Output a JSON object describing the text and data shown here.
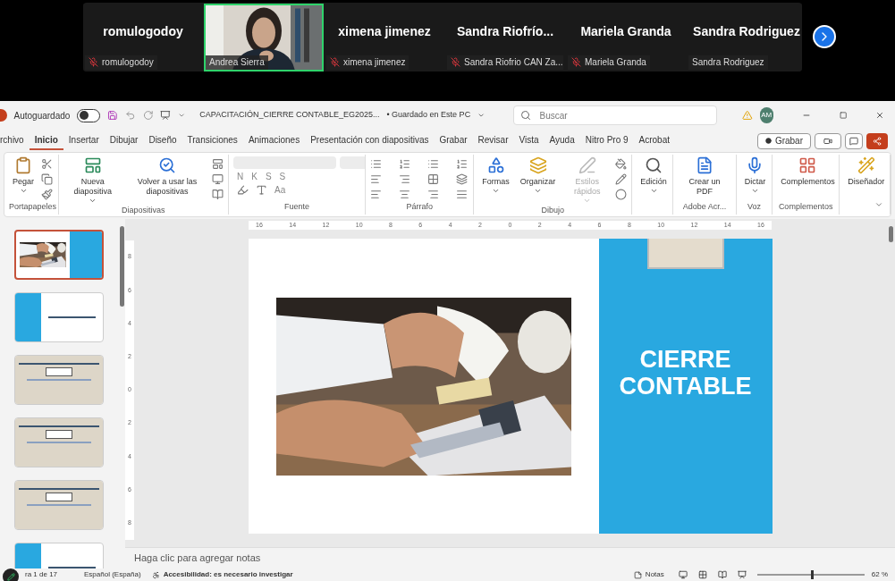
{
  "meeting": {
    "participants": [
      {
        "kind": "name",
        "name": "romulogodoy",
        "caption": "romulogodoy",
        "muted": true,
        "speaking": false
      },
      {
        "kind": "video",
        "caption": "Andrea Sierra",
        "muted": false,
        "speaking": true
      },
      {
        "kind": "name",
        "name": "ximena jimenez",
        "caption": "ximena jimenez",
        "muted": true,
        "speaking": false
      },
      {
        "kind": "name",
        "name": "Sandra  Riofrío...",
        "caption": "Sandra Riofrio CAN Za...",
        "muted": true,
        "speaking": false
      },
      {
        "kind": "name",
        "name": "Mariela Granda",
        "caption": "Mariela Granda",
        "muted": true,
        "speaking": false
      },
      {
        "kind": "name",
        "name": "Sandra Rodriguez",
        "caption": "Sandra Rodriguez",
        "muted": false,
        "speaking": false
      }
    ]
  },
  "title_bar": {
    "autosave_label": "Autoguardado",
    "autosave_on": false,
    "file_title": "CAPACITACIÓN_CIERRE CONTABLE_EG2025...",
    "save_status": "• Guardado en Este PC",
    "search_placeholder": "Buscar",
    "avatar": "AM"
  },
  "tabs": [
    {
      "label": "rchivo",
      "selected": false
    },
    {
      "label": "Inicio",
      "selected": true
    },
    {
      "label": "Insertar",
      "selected": false
    },
    {
      "label": "Dibujar",
      "selected": false
    },
    {
      "label": "Diseño",
      "selected": false
    },
    {
      "label": "Transiciones",
      "selected": false
    },
    {
      "label": "Animaciones",
      "selected": false
    },
    {
      "label": "Presentación con diapositivas",
      "selected": false
    },
    {
      "label": "Grabar",
      "selected": false
    },
    {
      "label": "Revisar",
      "selected": false
    },
    {
      "label": "Vista",
      "selected": false
    },
    {
      "label": "Ayuda",
      "selected": false
    },
    {
      "label": "Nitro Pro 9",
      "selected": false
    },
    {
      "label": "Acrobat",
      "selected": false
    }
  ],
  "record_button": "Grabar",
  "ribbon": [
    {
      "kind": "clipboard",
      "label": "Portapapeles",
      "buttons": [
        {
          "kind": "paste",
          "label": "Pegar",
          "dropdown": true,
          "disabled": false
        }
      ]
    },
    {
      "kind": "slides",
      "label": "Diapositivas",
      "buttons": [
        {
          "kind": "new-slide",
          "label": "Nueva diapositiva",
          "dropdown": true,
          "disabled": false
        },
        {
          "kind": "reuse",
          "label": "Volver a usar las diapositivas",
          "dropdown": false,
          "disabled": false
        }
      ]
    },
    {
      "kind": "font",
      "label": "Fuente",
      "letters": [
        "N",
        "K",
        "S",
        "S"
      ],
      "case_button": "Aa"
    },
    {
      "kind": "paragraph",
      "label": "Párrafo"
    },
    {
      "kind": "drawing",
      "label": "Dibujo",
      "buttons": [
        {
          "kind": "shapes",
          "label": "Formas",
          "dropdown": true,
          "disabled": false
        },
        {
          "kind": "arrange",
          "label": "Organizar",
          "dropdown": true,
          "disabled": false
        },
        {
          "kind": "styles",
          "label": "Estilos rápidos",
          "dropdown": true,
          "disabled": true
        }
      ]
    },
    {
      "kind": "plain",
      "buttons": [
        {
          "kind": "find",
          "label": "Edición",
          "dropdown": true,
          "disabled": false
        }
      ]
    },
    {
      "kind": "plain",
      "label": "Adobe Acr...",
      "buttons": [
        {
          "kind": "pdf",
          "label": "Crear un PDF",
          "dropdown": false,
          "disabled": false
        }
      ]
    },
    {
      "kind": "plain",
      "label": "Voz",
      "buttons": [
        {
          "kind": "mic",
          "label": "Dictar",
          "dropdown": true,
          "disabled": false
        }
      ]
    },
    {
      "kind": "plain",
      "label": "Complementos",
      "buttons": [
        {
          "kind": "addins",
          "label": "Complementos",
          "dropdown": false,
          "disabled": false
        }
      ]
    },
    {
      "kind": "plain",
      "buttons": [
        {
          "kind": "designer",
          "label": "Diseñador",
          "dropdown": false,
          "disabled": false
        }
      ]
    }
  ],
  "ruler": {
    "horizontal": [
      "16",
      "14",
      "12",
      "10",
      "8",
      "6",
      "4",
      "2",
      "0",
      "2",
      "4",
      "6",
      "8",
      "10",
      "12",
      "14",
      "16"
    ],
    "vertical": [
      "8",
      "6",
      "4",
      "2",
      "0",
      "2",
      "4",
      "6",
      "8"
    ]
  },
  "thumbnails": [
    {
      "kind": "title",
      "selected": true
    },
    {
      "kind": "blue-left",
      "selected": false
    },
    {
      "kind": "doc",
      "selected": false
    },
    {
      "kind": "doc",
      "selected": false
    },
    {
      "kind": "doc",
      "selected": false
    },
    {
      "kind": "blue-left",
      "selected": false
    }
  ],
  "slide": {
    "title_lines": [
      "CIERRE",
      "CONTABLE"
    ]
  },
  "notes_placeholder": "Haga clic para agregar notas",
  "status_bar": {
    "slide_count": "ra 1 de 17",
    "language": "Español (España)",
    "accessibility": "Accesibilidad: es necesario investigar",
    "notes": "Notas",
    "zoom": "62 %",
    "level": 0.5
  }
}
